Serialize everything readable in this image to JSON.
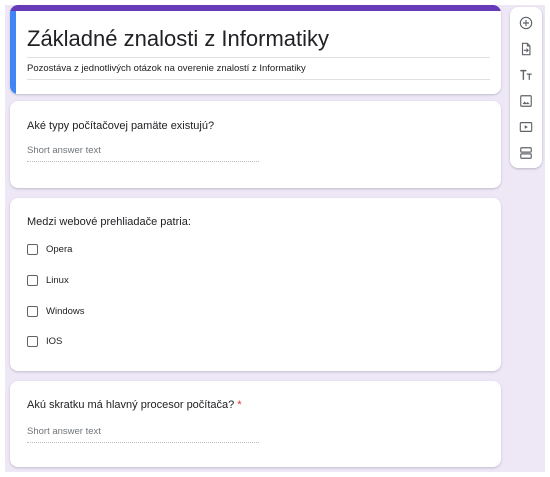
{
  "form": {
    "title": "Základné znalosti z Informatiky",
    "description": "Pozostáva z jednotlivých otázok na overenie znalostí z Informatiky"
  },
  "questions": [
    {
      "title": "Aké typy počítačovej pamäte existujú?",
      "type": "short-answer",
      "placeholder": "Short answer text"
    },
    {
      "title": "Medzi webové prehliadače patria:",
      "type": "checkboxes",
      "options": [
        "Opera",
        "Linux",
        "Windows",
        "IOS"
      ]
    },
    {
      "title": "Akú skratku má hlavný procesor počítača?",
      "required_marker": "*",
      "type": "short-answer",
      "placeholder": "Short answer text"
    }
  ],
  "toolbar": {
    "items": [
      "add-question-icon",
      "import-questions-icon",
      "add-title-icon",
      "add-image-icon",
      "add-video-icon",
      "add-section-icon"
    ]
  },
  "colors": {
    "theme_accent": "#673ab7",
    "focus_indicator": "#4285f4",
    "background": "#ede7f6",
    "required": "#d93025"
  }
}
